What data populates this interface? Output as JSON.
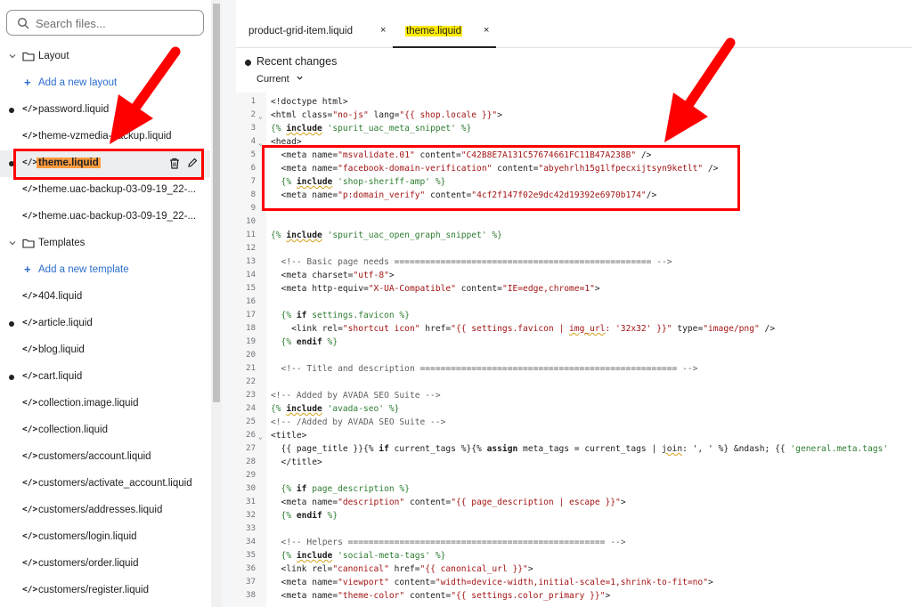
{
  "sidebar": {
    "search_placeholder": "Search files...",
    "sections": {
      "layout": "Layout",
      "add_layout": "Add a new layout",
      "templates": "Templates",
      "add_template": "Add a new template"
    },
    "files": {
      "f1": "password.liquid",
      "f2": "theme-vzmedia-backup.liquid",
      "f3": "theme.liquid",
      "f4": "theme.uac-backup-03-09-19_22-...",
      "f5": "theme.uac-backup-03-09-19_22-...",
      "t1": "404.liquid",
      "t2": "article.liquid",
      "t3": "blog.liquid",
      "t4": "cart.liquid",
      "t5": "collection.image.liquid",
      "t6": "collection.liquid",
      "t7": "customers/account.liquid",
      "t8": "customers/activate_account.liquid",
      "t9": "customers/addresses.liquid",
      "t10": "customers/login.liquid",
      "t11": "customers/order.liquid",
      "t12": "customers/register.liquid"
    },
    "code_glyph": "</>"
  },
  "tabs": {
    "tab1": "product-grid-item.liquid",
    "tab2": "theme.liquid",
    "close": "×"
  },
  "recent": {
    "title": "Recent changes",
    "current": "Current"
  },
  "code_lines": {
    "l1": "<!doctype html>",
    "l2a": "<html ",
    "l2b": "class=",
    "l2c": "\"no-js\"",
    "l2d": " lang=",
    "l2e": "\"{{ shop.locale }}\"",
    "l2f": ">",
    "l3a": "{% ",
    "l3b": "include",
    "l3c": " ",
    "l3d": "'spurit_uac_meta_snippet'",
    "l3e": " %}",
    "l4": "<head>",
    "l5a": "  <meta ",
    "l5b": "name=",
    "l5c": "\"msvalidate.01\"",
    "l5d": " content=",
    "l5e": "\"C42B8E7A131C57674661FC11B47A238B\"",
    "l5f": " />",
    "l6a": "  <meta ",
    "l6b": "name=",
    "l6c": "\"facebook-domain-verification\"",
    "l6d": " content=",
    "l6e": "\"abyehrlh15g1lfpecxijtsyn9ketlt\"",
    "l6f": " />",
    "l7a": "  {% ",
    "l7b": "include",
    "l7c": " ",
    "l7d": "'shop-sheriff-amp'",
    "l7e": " %}",
    "l8a": "  <meta ",
    "l8b": "name=",
    "l8c": "\"p:domain_verify\"",
    "l8d": " content=",
    "l8e": "\"4cf2f147f02e9dc42d19392e6970b174\"",
    "l8f": "/>",
    "l11a": "{% ",
    "l11b": "include",
    "l11c": " ",
    "l11d": "'spurit_uac_open_graph_snippet'",
    "l11e": " %}",
    "l13": "  <!-- Basic page needs ================================================== -->",
    "l14a": "  <meta ",
    "l14b": "charset=",
    "l14c": "\"utf-8\"",
    "l14d": ">",
    "l15a": "  <meta ",
    "l15b": "http-equiv=",
    "l15c": "\"X-UA-Compatible\"",
    "l15d": " content=",
    "l15e": "\"IE=edge,chrome=1\"",
    "l15f": ">",
    "l17a": "  {% ",
    "l17b": "if",
    "l17c": " settings.favicon %}",
    "l18a": "    <link ",
    "l18b": "rel=",
    "l18c": "\"shortcut icon\"",
    "l18d": " href=",
    "l18e": "\"{{ settings.favicon | ",
    "l18f": "img_url",
    "l18g": ": '32x32' }}\"",
    "l18h": " type=",
    "l18i": "\"image/png\"",
    "l18j": " />",
    "l19a": "  {% ",
    "l19b": "endif",
    "l19c": " %}",
    "l21": "  <!-- Title and description ================================================== -->",
    "l23": "<!-- Added by AVADA SEO Suite -->",
    "l24a": "{% ",
    "l24b": "include",
    "l24c": " ",
    "l24d": "'avada-seo'",
    "l24e": " %}",
    "l25": "<!-- /Added by AVADA SEO Suite -->",
    "l26": "<title>",
    "l27a": "  {{ page_title }}{% ",
    "l27b": "if",
    "l27c": " current_tags %}{% ",
    "l27d": "assign",
    "l27e": " meta_tags = current_tags | ",
    "l27f": "join",
    "l27g": ": ', ' %} &ndash; {{ ",
    "l27h": "'general.meta.tags'",
    "l28": "  </title>",
    "l30a": "  {% ",
    "l30b": "if",
    "l30c": " page_description %}",
    "l31a": "  <meta ",
    "l31b": "name=",
    "l31c": "\"description\"",
    "l31d": " content=",
    "l31e": "\"{{ page_description | ",
    "l31f": "escape",
    "l31g": " }}\"",
    "l31h": ">",
    "l32a": "  {% ",
    "l32b": "endif",
    "l32c": " %}",
    "l34": "  <!-- Helpers ================================================== -->",
    "l35a": "  {% ",
    "l35b": "include",
    "l35c": " ",
    "l35d": "'social-meta-tags'",
    "l35e": " %}",
    "l36a": "  <link ",
    "l36b": "rel=",
    "l36c": "\"canonical\"",
    "l36d": " href=",
    "l36e": "\"{{ canonical_url }}\"",
    "l36f": ">",
    "l37a": "  <meta ",
    "l37b": "name=",
    "l37c": "\"viewport\"",
    "l37d": " content=",
    "l37e": "\"width=device-width,initial-scale=1,shrink-to-fit=no\"",
    "l37f": ">",
    "l38a": "  <meta ",
    "l38b": "name=",
    "l38c": "\"theme-color\"",
    "l38d": " content=",
    "l38e": "\"{{ settings.color_primary }}\"",
    "l38f": ">"
  },
  "line_numbers": [
    "1",
    "2",
    "3",
    "4",
    "5",
    "6",
    "7",
    "8",
    "9",
    "10",
    "11",
    "12",
    "13",
    "14",
    "15",
    "16",
    "17",
    "18",
    "19",
    "20",
    "21",
    "22",
    "23",
    "24",
    "25",
    "26",
    "27",
    "28",
    "29",
    "30",
    "31",
    "32",
    "33",
    "34",
    "35",
    "36",
    "37",
    "38"
  ],
  "colors": {
    "annotation": "#ff0000",
    "selected_highlight": "#ff9b3d",
    "tab_highlight": "#ffeb00",
    "link_blue": "#2c6ecb"
  }
}
